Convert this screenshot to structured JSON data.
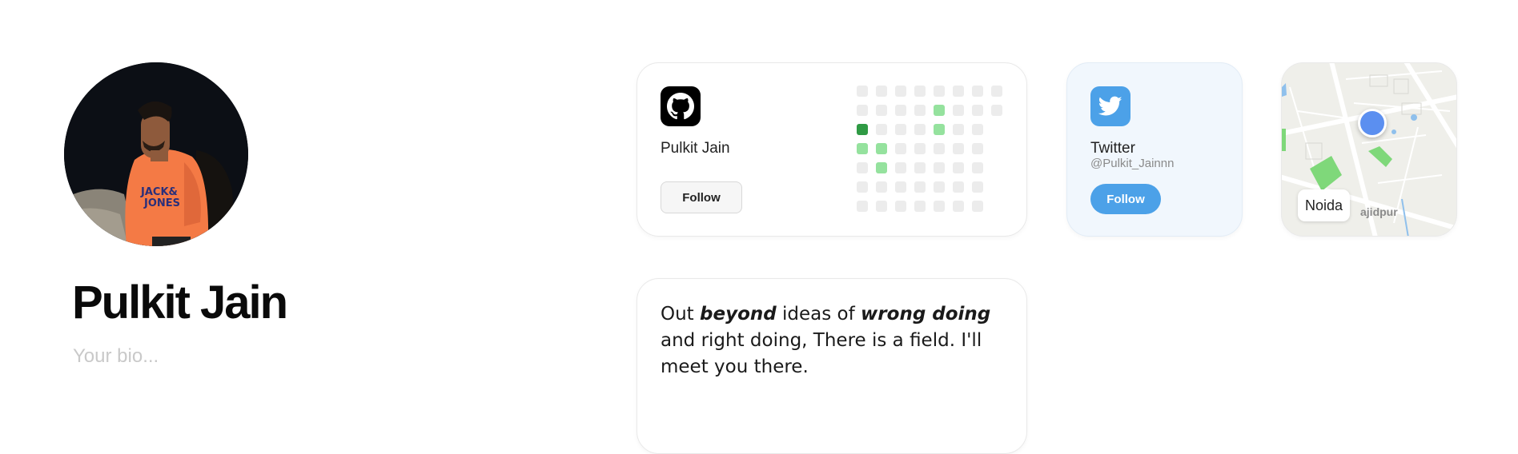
{
  "profile": {
    "name": "Pulkit Jain",
    "bio_placeholder": "Your bio...",
    "avatar_shirt_text": [
      "JACK&",
      "JONES"
    ]
  },
  "github_card": {
    "icon": "github-icon",
    "username": "Pulkit Jain",
    "follow_label": "Follow",
    "contributions": [
      [
        0,
        0,
        0,
        0,
        0,
        0,
        0,
        0
      ],
      [
        0,
        0,
        0,
        0,
        1,
        0,
        0,
        0
      ],
      [
        2,
        0,
        0,
        0,
        1,
        0,
        0
      ],
      [
        1,
        1,
        0,
        0,
        0,
        0,
        0
      ],
      [
        0,
        1,
        0,
        0,
        0,
        0,
        0
      ],
      [
        0,
        0,
        0,
        0,
        0,
        0,
        0
      ],
      [
        0,
        0,
        0,
        0,
        0,
        0,
        0
      ]
    ],
    "colors": {
      "empty": "#ececec",
      "light": "#95e29e",
      "dark": "#2f9a44"
    }
  },
  "twitter_card": {
    "icon": "twitter-bird-icon",
    "title": "Twitter",
    "handle": "@Pulkit_Jainnn",
    "follow_label": "Follow",
    "accent": "#4ca1e8"
  },
  "map_card": {
    "location_label": "Noida",
    "partial_place_label": "ajidpur"
  },
  "quote_card": {
    "parts": [
      {
        "text": "Out ",
        "emphasis": false
      },
      {
        "text": "beyond",
        "emphasis": true
      },
      {
        "text": " ideas of ",
        "emphasis": false
      },
      {
        "text": "wrong doing",
        "emphasis": true
      },
      {
        "text": " and right doing, There is a field. I'll meet you there.",
        "emphasis": false
      }
    ]
  }
}
